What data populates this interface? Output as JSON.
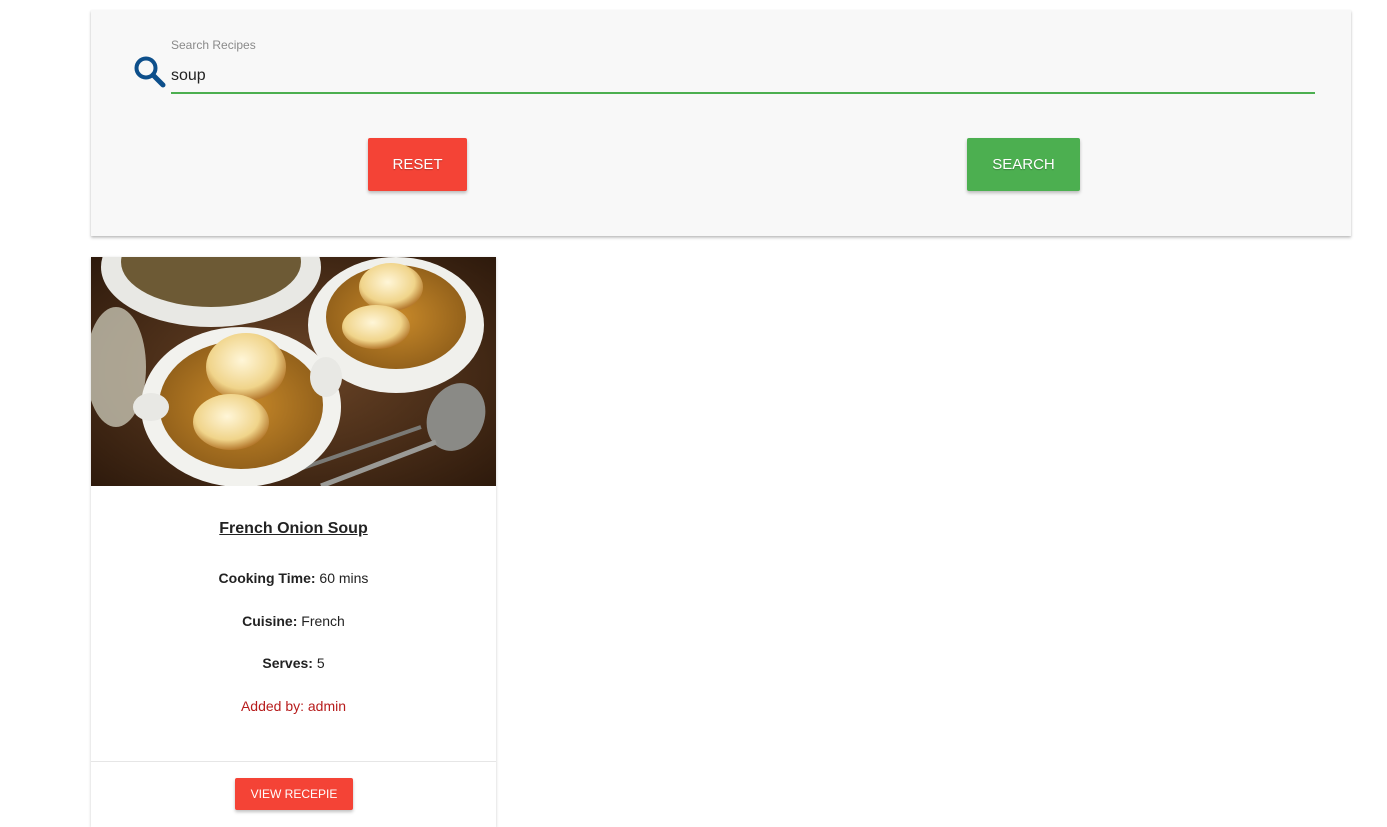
{
  "search": {
    "label": "Search Recipes",
    "value": "soup",
    "icon": "search-icon",
    "underline_color": "#4caf50"
  },
  "buttons": {
    "reset_label": "RESET",
    "search_label": "SEARCH",
    "reset_color": "#f44336",
    "search_color": "#4caf50"
  },
  "recipes": [
    {
      "title": "French Onion Soup",
      "cooking_time_label": "Cooking Time:",
      "cooking_time_value": "60 mins",
      "cuisine_label": "Cuisine:",
      "cuisine_value": "French",
      "serves_label": "Serves:",
      "serves_value": "5",
      "added_by": "Added by: admin",
      "view_label": "VIEW RECEPIE"
    }
  ]
}
